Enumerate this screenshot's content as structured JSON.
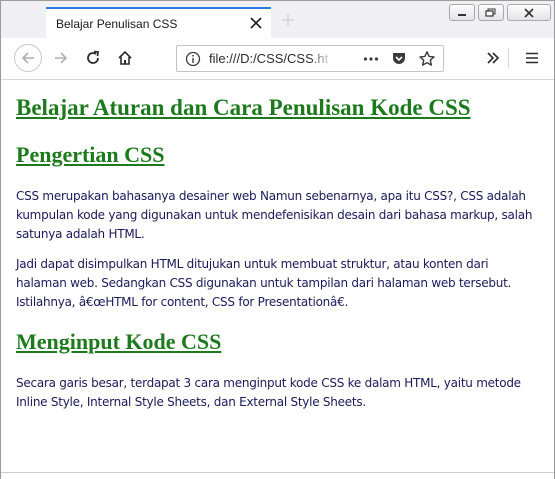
{
  "browser": {
    "tab_title": "Belajar Penulisan CSS",
    "url": "file:///D:/CSS/CSS.ht"
  },
  "icons": {
    "tab_close": "close-icon",
    "new_tab": "plus-icon",
    "minimize": "minimize-icon",
    "maximize": "restore-icon",
    "close_window": "close-icon",
    "back": "arrow-left-icon",
    "forward": "arrow-right-icon",
    "reload": "reload-icon",
    "home": "home-icon",
    "site_info": "info-icon",
    "page_actions": "more-dots-icon",
    "pocket": "pocket-icon",
    "bookmark": "star-icon",
    "overflow": "double-chevron-icon",
    "menu": "hamburger-icon"
  },
  "colors": {
    "heading": "#1c7a1c",
    "body_text": "#1a1a5a",
    "tab_accent": "#2a7de1"
  },
  "page": {
    "title": "Belajar Aturan dan Cara Penulisan Kode CSS",
    "section1_heading": "Pengertian CSS",
    "section1_p1": "CSS merupakan bahasanya desainer web Namun sebenarnya, apa itu CSS?, CSS adalah kumpulan kode yang digunakan untuk mendefenisikan desain dari bahasa markup, salah satunya adalah HTML.",
    "section1_p2": "Jadi dapat disimpulkan HTML ditujukan untuk membuat struktur, atau konten dari halaman web. Sedangkan CSS digunakan untuk tampilan dari halaman web tersebut. Istilahnya, â€œHTML for content, CSS for Presentationâ€.",
    "section2_heading": "Menginput Kode CSS",
    "section2_p1": "Secara garis besar, terdapat 3 cara menginput kode CSS ke dalam HTML, yaitu metode Inline Style, Internal Style Sheets, dan External Style Sheets."
  }
}
